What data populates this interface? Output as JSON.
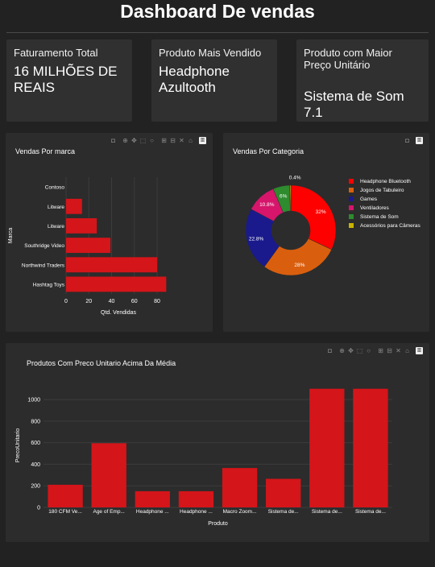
{
  "page": {
    "title": "Dashboard De vendas"
  },
  "cards": [
    {
      "label": "Faturamento Total",
      "value": "16 MILHÕES DE REAIS"
    },
    {
      "label": "Produto Mais Vendido",
      "value": "Headphone Azultooth"
    },
    {
      "label": "Produto com Maior Preço Unitário",
      "value": "Sistema de Som 7.1"
    }
  ],
  "toolbar_icons": [
    "camera-icon",
    "zoom-icon",
    "pan-icon",
    "box-select-icon",
    "lasso-select-icon",
    "zoom-in-icon",
    "zoom-out-icon",
    "autoscale-icon",
    "reset-axes-icon",
    "plotly-logo-icon"
  ],
  "colors": {
    "bar": "#d4151a",
    "panel": "#2c2c2c",
    "background": "#222222"
  },
  "chart_data": [
    {
      "type": "bar",
      "orientation": "horizontal",
      "title": "Vendas Por marca",
      "xlabel": "Qtd. Vendidas",
      "ylabel": "Marca",
      "categories": [
        "Contoso",
        "Litware",
        "Litware",
        "Southridge Video",
        "Northwind Traders",
        "Hashtag Toys"
      ],
      "values": [
        0,
        14,
        27,
        39,
        80,
        88
      ],
      "xticks": [
        0,
        20,
        40,
        60,
        80
      ],
      "xlim": [
        0,
        92
      ]
    },
    {
      "type": "pie",
      "hole": true,
      "title": "Vendas Por Categoria",
      "labels": [
        "Headphone Bluetooth",
        "Jogos de Tabuleiro",
        "Games",
        "Ventiladores",
        "Sistema de Som",
        "Acessórios para Câmeras"
      ],
      "values": [
        32,
        28,
        22.8,
        10.8,
        6,
        0.4
      ],
      "value_labels": [
        "32%",
        "28%",
        "22.8%",
        "10.8%",
        "6%",
        "0.4%"
      ],
      "colors": [
        "#ff0000",
        "#d95f0e",
        "#1a1a8c",
        "#d6156b",
        "#2e8b2e",
        "#c8b400"
      ]
    },
    {
      "type": "bar",
      "title": "Produtos Com Preco Unitario Acima Da Média",
      "xlabel": "Produto",
      "ylabel": "PrecoUnitario",
      "categories": [
        "180 CFM Ve...",
        "Age of Emp...",
        "Headphone ...",
        "Headphone ...",
        "Macro Zoom...",
        "Sistema de...",
        "Sistema de...",
        "Sistema de..."
      ],
      "values": [
        210,
        595,
        150,
        150,
        365,
        265,
        1100,
        1100
      ],
      "yticks": [
        0,
        200,
        400,
        600,
        800,
        1000
      ],
      "ylim": [
        0,
        1150
      ]
    }
  ]
}
